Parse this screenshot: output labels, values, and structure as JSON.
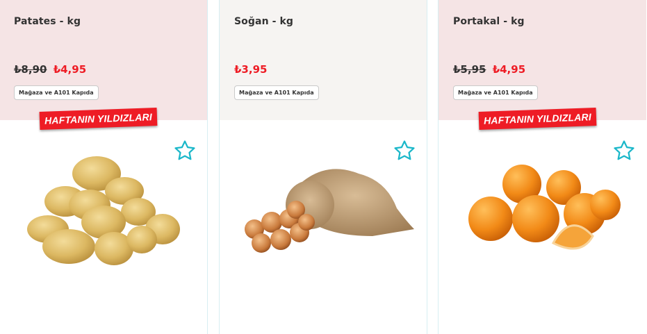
{
  "colors": {
    "highlight_bg": "#f5e4e5",
    "neutral_bg": "#f6f4f2",
    "price_red": "#ee1c25",
    "star_teal": "#1ab7c9"
  },
  "products": [
    {
      "title": "Patates - kg",
      "old_price": "₺8,90",
      "price": "₺4,95",
      "availability": "Mağaza ve A101 Kapıda",
      "label": "HAFTANIN YILDIZLARI",
      "favorite_icon": "star-outline-icon",
      "image": "potatoes-image"
    },
    {
      "title": "Soğan - kg",
      "old_price": "",
      "price": "₺3,95",
      "availability": "Mağaza ve A101 Kapıda",
      "label": "",
      "favorite_icon": "star-outline-icon",
      "image": "onion-sack-image"
    },
    {
      "title": "Portakal - kg",
      "old_price": "₺5,95",
      "price": "₺4,95",
      "availability": "Mağaza ve A101 Kapıda",
      "label": "HAFTANIN YILDIZLARI",
      "favorite_icon": "star-outline-icon",
      "image": "oranges-image"
    }
  ]
}
